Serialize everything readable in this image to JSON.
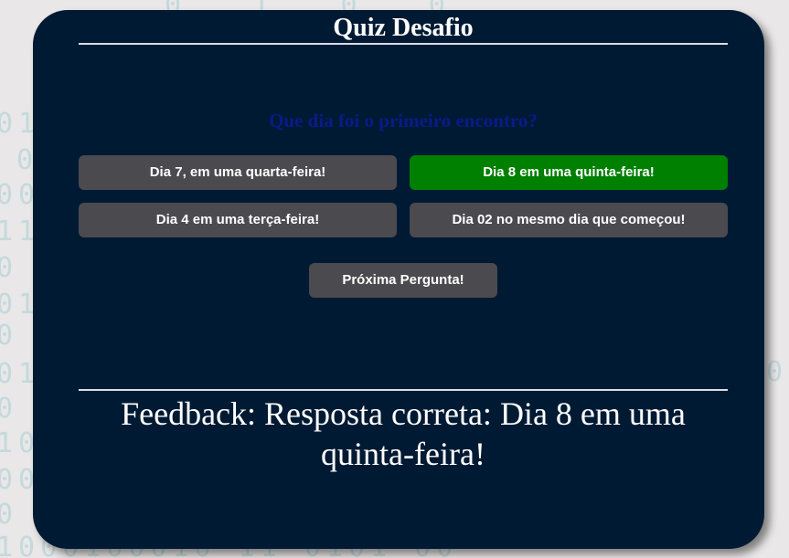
{
  "quiz": {
    "title": "Quiz Desafio",
    "question": "Que dia foi o primeiro encontro?",
    "answers": [
      {
        "label": "Dia 7, em uma quarta-feira!",
        "state": "default"
      },
      {
        "label": "Dia 8 em uma quinta-feira!",
        "state": "correct"
      },
      {
        "label": "Dia 4 em uma terça-feira!",
        "state": "default"
      },
      {
        "label": "Dia 02 no mesmo dia que começou!",
        "state": "default"
      }
    ],
    "next_label": "Próxima Pergunta!",
    "feedback": "Feedback: Resposta correta: Dia 8 em uma quinta-feira!"
  },
  "colors": {
    "page_background": "#e9e7e7",
    "card_background": "#001a33",
    "button_default": "#4a4a4f",
    "button_correct": "#008000",
    "question_text": "#0a1a8a",
    "background_digits": "#a6cfd6"
  }
}
